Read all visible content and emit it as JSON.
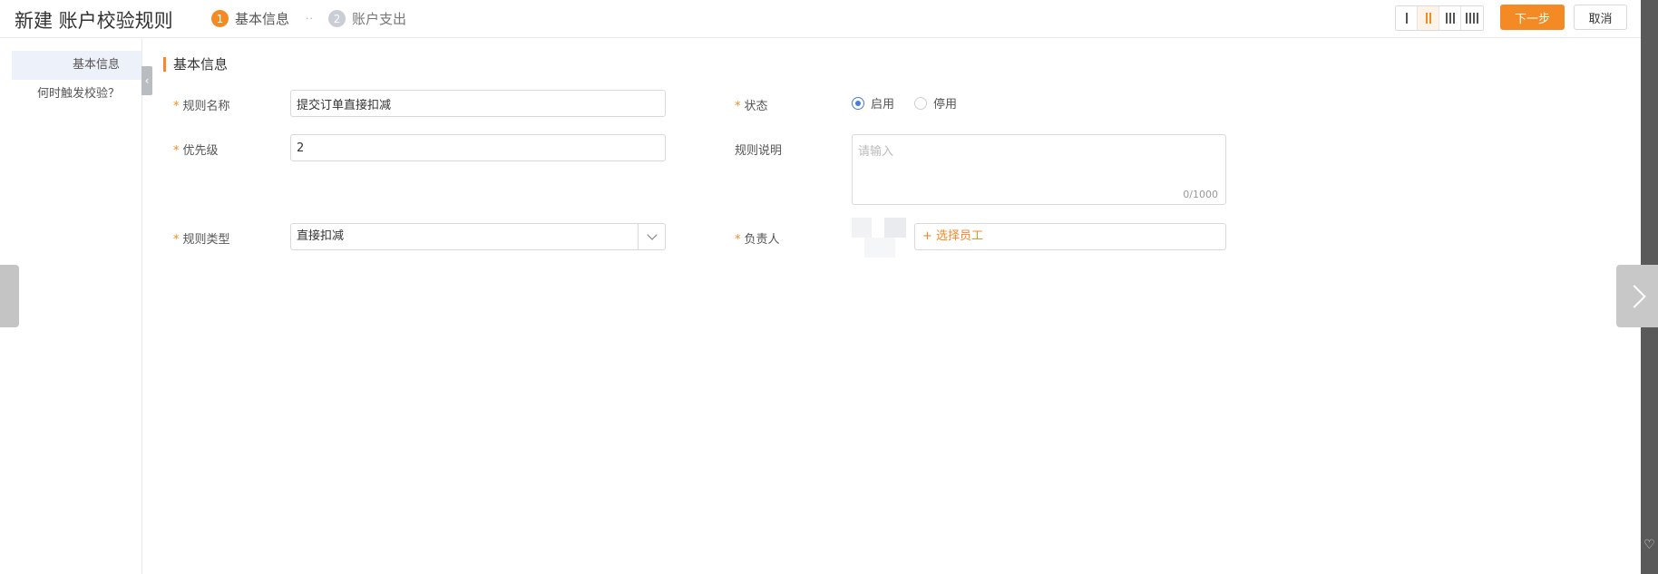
{
  "header": {
    "title": "新建 账户校验规则",
    "steps": [
      {
        "num": "1",
        "label": "基本信息",
        "state": "active"
      },
      {
        "num": "2",
        "label": "账户支出",
        "state": "inactive"
      }
    ],
    "step_separator": "··",
    "layout_options": [
      "I",
      "II",
      "III",
      "IIII"
    ],
    "layout_selected": "II",
    "next_label": "下一步",
    "cancel_label": "取消"
  },
  "sidebar": {
    "items": [
      {
        "label": "基本信息",
        "active": true
      },
      {
        "label": "何时触发校验？",
        "active": false
      }
    ]
  },
  "form": {
    "section_title": "基本信息",
    "rule_name": {
      "label": "规则名称",
      "required": true,
      "value": "提交订单直接扣减"
    },
    "status": {
      "label": "状态",
      "required": true,
      "options": [
        "启用",
        "停用"
      ],
      "selected": "启用"
    },
    "priority": {
      "label": "优先级",
      "required": true,
      "value": "2"
    },
    "description": {
      "label": "规则说明",
      "required": false,
      "placeholder": "请输入",
      "counter": "0/1000"
    },
    "rule_type": {
      "label": "规则类型",
      "required": true,
      "value": "直接扣减"
    },
    "owner": {
      "label": "负责人",
      "required": true,
      "pick_label": "+ 选择员工"
    }
  },
  "colors": {
    "accent": "#f38a24",
    "radio_checked": "#4a7bd8",
    "sidebar_active_bg": "#edf1f9"
  }
}
